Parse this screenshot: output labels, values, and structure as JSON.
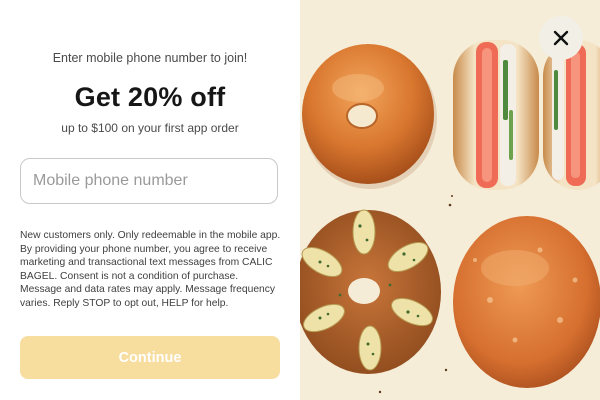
{
  "signup": {
    "eyebrow": "Enter mobile phone number to join!",
    "headline": "Get 20% off",
    "subheadline": "up to $100 on your first app order",
    "phone_placeholder": "Mobile phone number",
    "phone_value": "",
    "legal": "New customers only. Only redeemable in the mobile app. By providing your phone number, you agree to receive marketing and transactional text messages from CALIC BAGEL. Consent is not a condition of purchase. Message and data rates may apply. Message frequency varies. Reply STOP to opt out, HELP for help.",
    "continue_label": "Continue"
  },
  "close_icon": "close-icon",
  "colors": {
    "continue_disabled": "#f7dd9e",
    "image_background": "#f5edd8",
    "text_primary": "#161616"
  }
}
